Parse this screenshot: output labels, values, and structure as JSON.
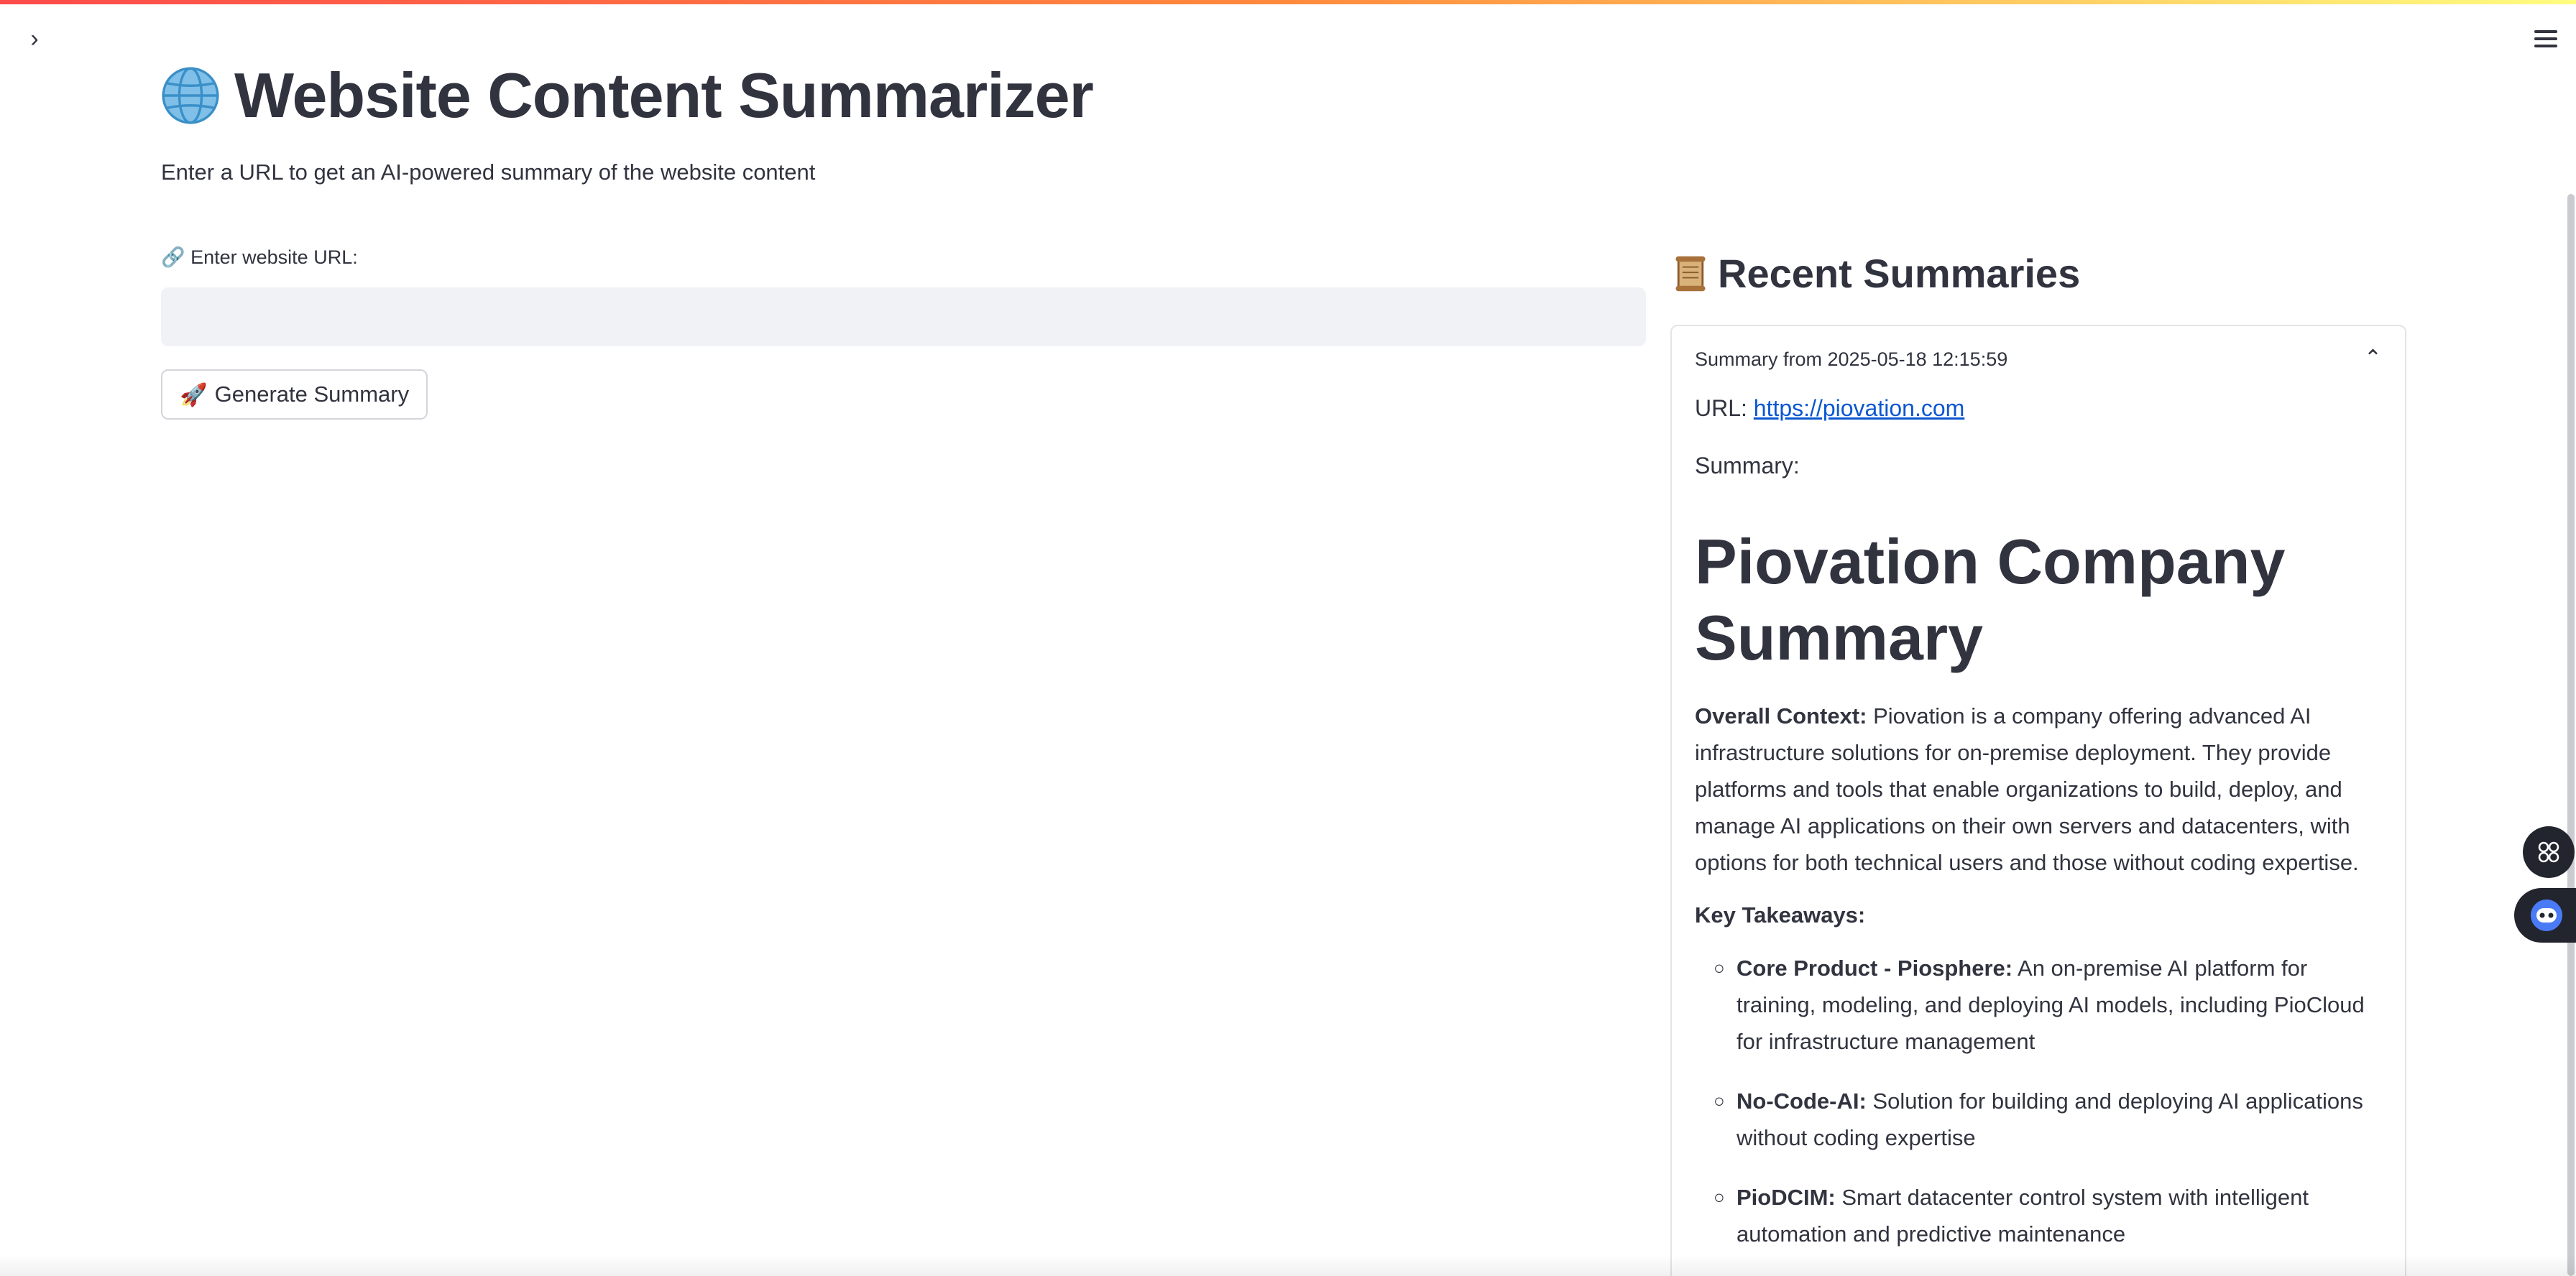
{
  "app": {
    "title": "Website Content Summarizer",
    "subtitle": "Enter a URL to get an AI-powered summary of the website content"
  },
  "form": {
    "url_label": "🔗 Enter website URL:",
    "url_value": "",
    "generate_label": "Generate Summary",
    "generate_emoji": "🚀"
  },
  "recent": {
    "header": "Recent Summaries",
    "item": {
      "expander_title": "Summary from 2025-05-18 12:15:59",
      "url_prefix": "URL: ",
      "url": "https://piovation.com",
      "summary_label": "Summary:",
      "heading": "Piovation Company Summary",
      "overall_label": "Overall Context:",
      "overall_text": " Piovation is a company offering advanced AI infrastructure solutions for on-premise deployment. They provide platforms and tools that enable organizations to build, deploy, and manage AI applications on their own servers and datacenters, with options for both technical users and those without coding expertise.",
      "key_label": "Key Takeaways:",
      "takeaways": [
        {
          "title": "Core Product - Piosphere:",
          "text": " An on-premise AI platform for training, modeling, and deploying AI models, including PioCloud for infrastructure management"
        },
        {
          "title": "No-Code-AI:",
          "text": " Solution for building and deploying AI applications without coding expertise"
        },
        {
          "title": "PioDCIM:",
          "text": " Smart datacenter control system with intelligent automation and predictive maintenance"
        }
      ]
    }
  },
  "icons": {
    "sidebar_toggle": "chevron-right-icon",
    "menu": "hamburger-menu-icon",
    "title_icon": "globe-icon",
    "recent_icon": "scroll-icon",
    "expander_toggle": "chevron-up-icon",
    "float_1": "grid-apps-icon",
    "float_2": "bot-assistant-icon"
  },
  "colors": {
    "link": "#0b57d0",
    "input_bg": "#f0f2f6",
    "text": "#31333f"
  }
}
